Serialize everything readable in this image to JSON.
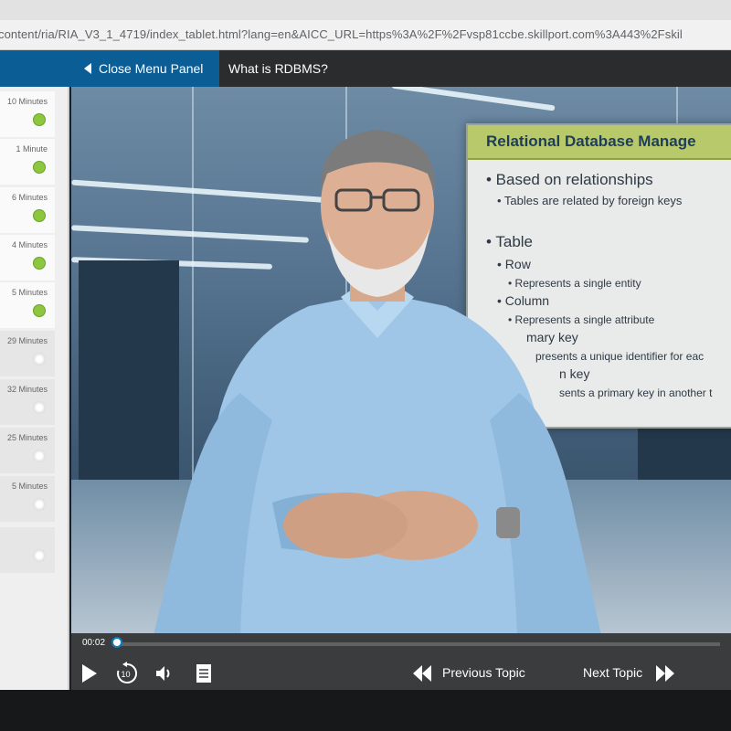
{
  "browser": {
    "url": "content/ria/RIA_V3_1_4719/index_tablet.html?lang=en&AICC_URL=https%3A%2F%2Fvsp81ccbe.skillport.com%3A443%2Fskil"
  },
  "header": {
    "close_menu_label": "Close Menu Panel",
    "topic_title": "What is RDBMS?"
  },
  "sidebar": {
    "items": [
      {
        "duration": "10 Minutes",
        "status": "complete"
      },
      {
        "duration": "1 Minute",
        "status": "complete"
      },
      {
        "duration": "6 Minutes",
        "status": "complete"
      },
      {
        "duration": "4 Minutes",
        "status": "complete"
      },
      {
        "duration": "5 Minutes",
        "status": "complete"
      },
      {
        "duration": "29 Minutes",
        "status": "not-started"
      },
      {
        "duration": "32 Minutes",
        "status": "not-started"
      },
      {
        "duration": "25 Minutes",
        "status": "not-started"
      },
      {
        "duration": "5 Minutes",
        "status": "not-started"
      },
      {
        "duration": "",
        "status": "not-started"
      }
    ]
  },
  "slide": {
    "title": "Relational Database Manage",
    "lines": [
      "• Based on relationships",
      "• Tables are related by foreign keys",
      "• Table",
      "• Row",
      "• Represents a single entity",
      "• Column",
      "• Represents a single attribute",
      "mary key",
      "presents a unique identifier for eac",
      "n key",
      "sents a primary key in another t"
    ]
  },
  "player": {
    "current_time": "00:02",
    "progress_fraction": 0.0,
    "previous_label": "Previous Topic",
    "next_label": "Next Topic",
    "icons": [
      "play-icon",
      "replay-10-icon",
      "volume-icon",
      "transcript-icon",
      "previous-topic-icon",
      "next-topic-icon"
    ]
  },
  "colors": {
    "accent_blue": "#0b5d96",
    "complete_green": "#8dc63f",
    "slide_header": "#b7c96b"
  }
}
